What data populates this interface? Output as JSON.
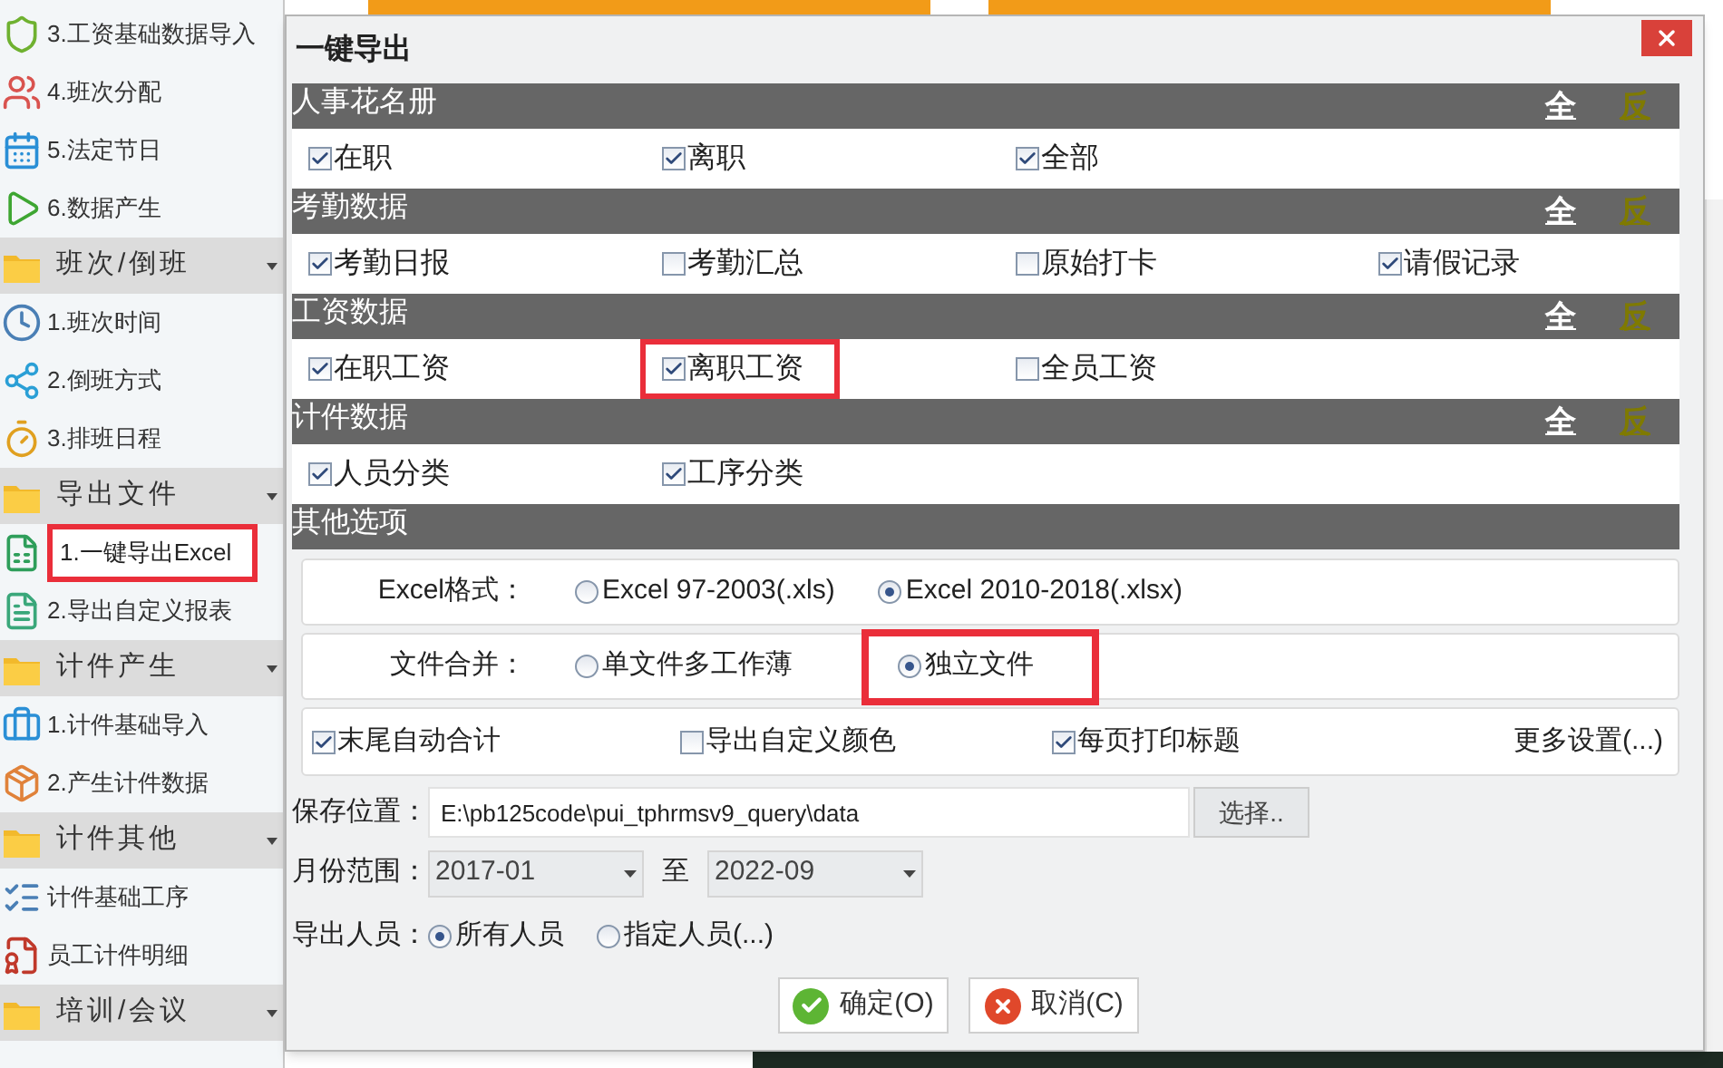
{
  "sidebar": {
    "items": [
      {
        "kind": "item",
        "label": "3.工资基础数据导入",
        "highlighted": false
      },
      {
        "kind": "item",
        "label": "4.班次分配",
        "highlighted": false
      },
      {
        "kind": "item",
        "label": "5.法定节日",
        "highlighted": false
      },
      {
        "kind": "item",
        "label": "6.数据产生",
        "highlighted": false
      },
      {
        "kind": "group",
        "label": "班次/倒班"
      },
      {
        "kind": "item",
        "label": "1.班次时间",
        "highlighted": false
      },
      {
        "kind": "item",
        "label": "2.倒班方式",
        "highlighted": false
      },
      {
        "kind": "item",
        "label": "3.排班日程",
        "highlighted": false
      },
      {
        "kind": "group",
        "label": "导出文件"
      },
      {
        "kind": "item",
        "label": "1.一键导出Excel",
        "highlighted": true
      },
      {
        "kind": "item",
        "label": "2.导出自定义报表",
        "highlighted": false
      },
      {
        "kind": "group",
        "label": "计件产生"
      },
      {
        "kind": "item",
        "label": "1.计件基础导入",
        "highlighted": false
      },
      {
        "kind": "item",
        "label": "2.产生计件数据",
        "highlighted": false
      },
      {
        "kind": "group",
        "label": "计件其他"
      },
      {
        "kind": "item",
        "label": "计件基础工序",
        "highlighted": false
      },
      {
        "kind": "item",
        "label": "员工计件明细",
        "highlighted": false
      },
      {
        "kind": "group",
        "label": "培训/会议"
      }
    ]
  },
  "dialog": {
    "title": "一键导出",
    "sections": [
      {
        "title": "人事花名册",
        "all_label": "全",
        "invert_label": "反",
        "options": [
          {
            "label": "在职",
            "checked": true,
            "highlighted": false
          },
          {
            "label": "离职",
            "checked": true,
            "highlighted": false
          },
          {
            "label": "全部",
            "checked": true,
            "highlighted": false
          }
        ]
      },
      {
        "title": "考勤数据",
        "all_label": "全",
        "invert_label": "反",
        "options": [
          {
            "label": "考勤日报",
            "checked": true,
            "highlighted": false
          },
          {
            "label": "考勤汇总",
            "checked": false,
            "highlighted": false
          },
          {
            "label": "原始打卡",
            "checked": false,
            "highlighted": false
          },
          {
            "label": "请假记录",
            "checked": true,
            "highlighted": false
          }
        ]
      },
      {
        "title": "工资数据",
        "all_label": "全",
        "invert_label": "反",
        "options": [
          {
            "label": "在职工资",
            "checked": true,
            "highlighted": false
          },
          {
            "label": "离职工资",
            "checked": true,
            "highlighted": true
          },
          {
            "label": "全员工资",
            "checked": false,
            "highlighted": false
          }
        ]
      },
      {
        "title": "计件数据",
        "all_label": "全",
        "invert_label": "反",
        "options": [
          {
            "label": "人员分类",
            "checked": true,
            "highlighted": false
          },
          {
            "label": "工序分类",
            "checked": true,
            "highlighted": false
          }
        ]
      }
    ],
    "other_title": "其他选项",
    "excel_format": {
      "label": "Excel格式：",
      "options": [
        {
          "label": "Excel 97-2003(.xls)",
          "selected": false,
          "highlighted": false
        },
        {
          "label": "Excel 2010-2018(.xlsx)",
          "selected": true,
          "highlighted": false
        }
      ]
    },
    "file_merge": {
      "label": "文件合并：",
      "options": [
        {
          "label": "单文件多工作薄",
          "selected": false,
          "highlighted": false
        },
        {
          "label": "独立文件",
          "selected": true,
          "highlighted": true
        }
      ]
    },
    "extras": {
      "options": [
        {
          "label": "末尾自动合计",
          "checked": true
        },
        {
          "label": "导出自定义颜色",
          "checked": false
        },
        {
          "label": "每页打印标题",
          "checked": true
        }
      ],
      "more_link": "更多设置(...)"
    },
    "save_location": {
      "label": "保存位置：",
      "value": "E:\\pb125code\\pui_tphrmsv9_query\\data",
      "button": "选择.."
    },
    "month_range": {
      "label": "月份范围：",
      "from": "2017-01",
      "separator": "至",
      "to": "2022-09"
    },
    "export_people": {
      "label": "导出人员：",
      "options": [
        {
          "label": "所有人员",
          "selected": true
        },
        {
          "label": "指定人员(...)",
          "selected": false
        }
      ]
    },
    "buttons": [
      {
        "kind": "ok",
        "label": "确定(O)"
      },
      {
        "kind": "cancel",
        "label": "取消(C)"
      }
    ]
  }
}
